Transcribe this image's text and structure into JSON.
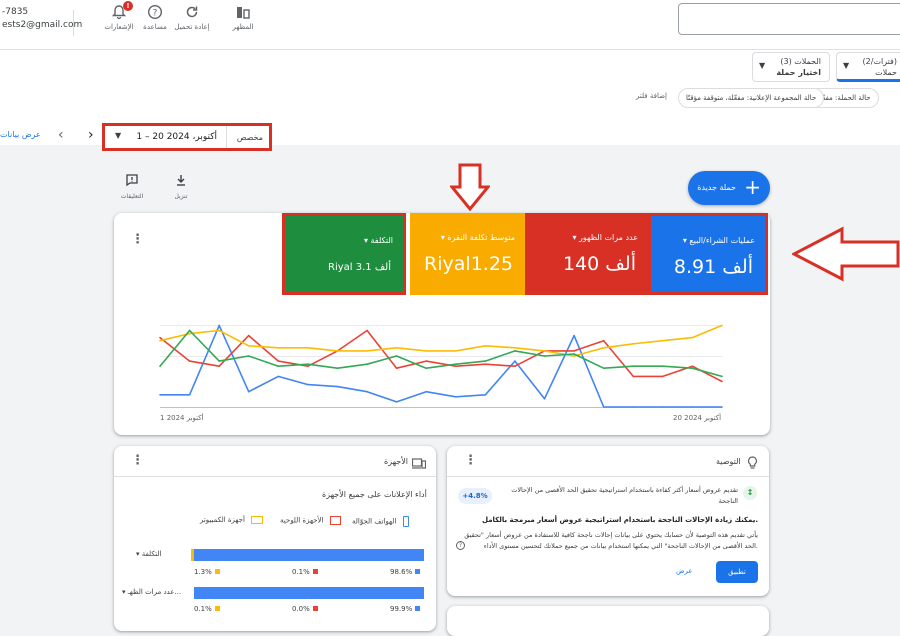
{
  "account": {
    "phone": "-7835",
    "email": "ests2@gmail.com"
  },
  "toolbar": {
    "notifications": "الإشعارات",
    "notifications_count": "!",
    "help": "مساعدة",
    "refresh": "إعادة تحميل",
    "appearance": "المظهر"
  },
  "campaign_selector": {
    "campaigns_title": "الحملات (3)",
    "campaigns_value": "اختيار حملة",
    "views_title": "(فترات/2)",
    "views_value": "حملات"
  },
  "filters": {
    "chip_status": "حالة الحملة: مفعّلة",
    "chip_adgroup": "حالة المجموعة الإعلانية: مفعّلة، متوقفة مؤقتًا",
    "add_filter": "إضافة فلتر"
  },
  "date": {
    "custom": "مخصص",
    "range": "1 – 20 أكتوبر، 2024",
    "view_data": "عرض بيانات"
  },
  "actions": {
    "comments": "التعليقات",
    "download": "تنزيل",
    "new_campaign": "حملة جديدة"
  },
  "tiles": [
    {
      "label": "عمليات الشراء/البيع",
      "value": "8.91 ألف",
      "color": "#1a73e8"
    },
    {
      "label": "عدد مرات الظهور",
      "value": "140 ألف",
      "color": "#d93025"
    },
    {
      "label": "متوسط تكلفة النقرة",
      "value": "Riyal1.25",
      "color": "#f9ab00"
    },
    {
      "label": "التكلفة",
      "value": "Riyal 3.1 ألف",
      "color": "#1e8e3e"
    }
  ],
  "chart_data": {
    "type": "line",
    "x_start_label": "1 أكتوبر 2024",
    "x_end_label": "20 أكتوبر 2024",
    "x": [
      1,
      2,
      3,
      4,
      5,
      6,
      7,
      8,
      9,
      10,
      11,
      12,
      13,
      14,
      15,
      16,
      17,
      18,
      19,
      20
    ],
    "series": [
      {
        "name": "عمليات الشراء/البيع",
        "color": "#4285f4",
        "values": [
          12,
          12,
          80,
          15,
          30,
          22,
          20,
          15,
          5,
          15,
          10,
          12,
          45,
          8,
          70,
          0,
          0,
          0,
          0,
          0
        ]
      },
      {
        "name": "عدد مرات الظهور",
        "color": "#ea4335",
        "values": [
          68,
          45,
          40,
          70,
          45,
          40,
          55,
          75,
          38,
          45,
          40,
          42,
          40,
          55,
          55,
          65,
          30,
          30,
          40,
          25
        ]
      },
      {
        "name": "متوسط تكلفة النقرة",
        "color": "#fbbc04",
        "values": [
          65,
          72,
          75,
          60,
          58,
          58,
          55,
          55,
          58,
          55,
          55,
          60,
          58,
          55,
          50,
          58,
          62,
          65,
          68,
          80
        ]
      },
      {
        "name": "التكلفة",
        "color": "#34a853",
        "values": [
          40,
          75,
          45,
          50,
          40,
          42,
          38,
          42,
          50,
          38,
          42,
          45,
          55,
          50,
          52,
          38,
          40,
          40,
          38,
          30
        ]
      }
    ]
  },
  "devices": {
    "title": "الأجهزة",
    "subtitle": "أداء الإعلانات على جميع الأجهزة",
    "legend": [
      "الهواتف الجوّالة",
      "الأجهزة اللوحية",
      "أجهزة الكمبيوتر"
    ],
    "colors": [
      "#4285f4",
      "#ea4335",
      "#fbbc04"
    ],
    "rows": [
      {
        "label": "التكلفة",
        "mobile": "98.6%",
        "tablet": "0.1%",
        "desktop": "1.3%",
        "mobile_share": 98.6
      },
      {
        "label": "عدد مرات الظهـ...",
        "mobile": "99.9%",
        "tablet": "0.0%",
        "desktop": "0.1%",
        "mobile_share": 99.9
      }
    ]
  },
  "recommendation": {
    "header": "التوصية",
    "line1": "تقديم عروض أسعار أكثر كفاءة باستخدام استراتيجية تحقيق الحد الأقصى من الإحالات",
    "line1b": "الناجحة",
    "uplift": "+4.8%",
    "title": "يمكنك زيادة الإحالات الناجحة باستخدام استراتيجية عروض أسعار مبرمجة بالكامل.",
    "body1": "يأتي تقديم هذه التوصية لأن حسابك يحتوي على بيانات إحالات ناجحة كافية للاستفادة من عروض أسعار \"تحقيق",
    "body2": "الحد الأقصى من الإحالات الناجحة\" التي يمكنها استخدام بيانات من جميع حملاتك لتحسين مستوى الأداء.",
    "apply": "تطبيق",
    "view": "عرض"
  }
}
